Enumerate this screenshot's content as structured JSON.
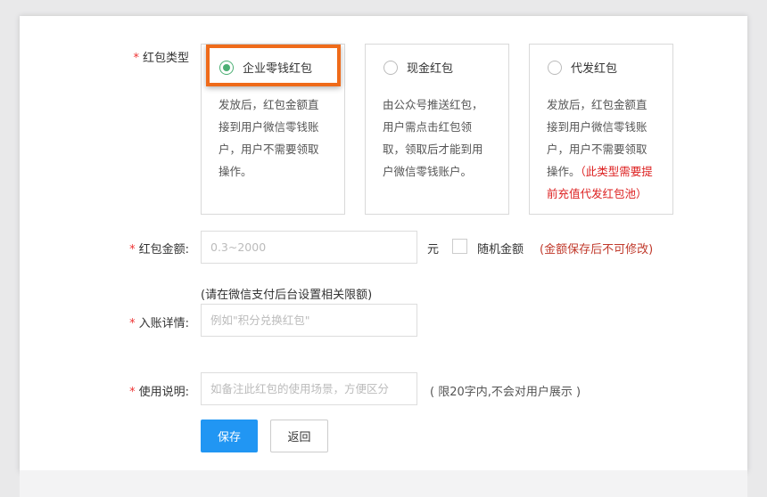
{
  "form": {
    "type_label": "红包类型",
    "options": [
      {
        "label": "企业零钱红包",
        "selected": true,
        "desc": "发放后，红包金额直接到用户微信零钱账户，用户不需要领取操作。",
        "warning": ""
      },
      {
        "label": "现金红包",
        "selected": false,
        "desc": "由公众号推送红包，用户需点击红包领取，领取后才能到用户微信零钱账户。",
        "warning": ""
      },
      {
        "label": "代发红包",
        "selected": false,
        "desc": "发放后，红包金额直接到用户微信零钱账户，用户不需要领取操作。",
        "warning": "（此类型需要提前充值代发红包池）"
      }
    ],
    "amount_label": "红包金额:",
    "amount_placeholder": "0.3~2000",
    "amount_unit": "元",
    "random_label": "随机金额",
    "random_checked": false,
    "amount_note": "(金额保存后不可修改)",
    "limit_hint": "(请在微信支付后台设置相关限额)",
    "detail_label": "入账详情:",
    "detail_placeholder": "例如\"积分兑换红包\"",
    "usage_label": "使用说明:",
    "usage_placeholder": "如备注此红包的使用场景，方便区分",
    "usage_note": "( 限20字内,不会对用户展示 )",
    "save_label": "保存",
    "back_label": "返回"
  },
  "colors": {
    "highlight": "#ef6b1a",
    "primary": "#2196f3",
    "radio": "#4caf74",
    "warning": "#d22"
  }
}
